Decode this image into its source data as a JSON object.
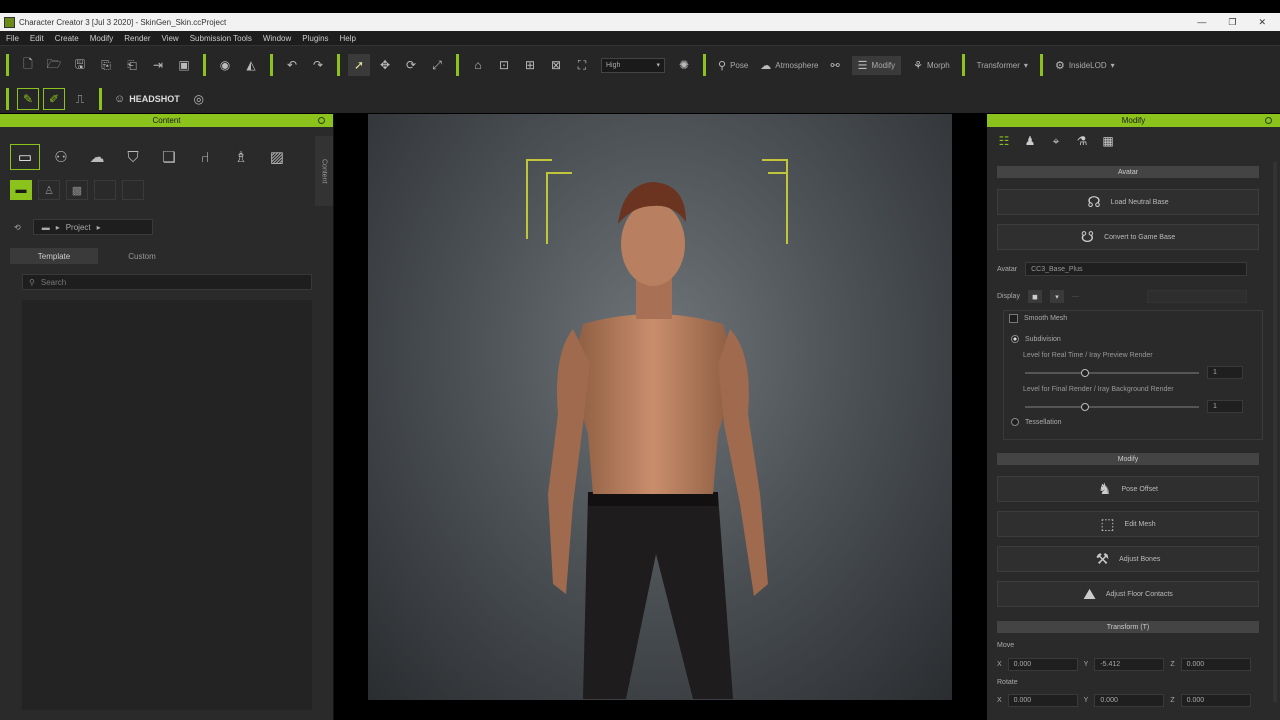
{
  "window": {
    "title": "Character Creator 3 [Jul 3 2020] - SkinGen_Skin.ccProject"
  },
  "menu": [
    "File",
    "Edit",
    "Create",
    "Modify",
    "Render",
    "View",
    "Submission Tools",
    "Window",
    "Plugins",
    "Help"
  ],
  "toolbar": {
    "quality": "High",
    "pose": "Pose",
    "atmosphere": "Atmosphere",
    "modify": "Modify",
    "morph": "Morph",
    "transformer": "Transformer",
    "insideLod": "InsideLOD",
    "headshot": "HEADSHOT"
  },
  "content": {
    "title": "Content",
    "side_tab": "Content",
    "project": "Project",
    "tabs": [
      "Template",
      "Custom"
    ],
    "search_placeholder": "Search"
  },
  "modify": {
    "title": "Modify",
    "avatar_section": "Avatar",
    "load_neutral": "Load Neutral Base",
    "convert_game": "Convert to Game Base",
    "avatar_label": "Avatar",
    "avatar_value": "CC3_Base_Plus",
    "display_label": "Display",
    "smooth_mesh": "Smooth Mesh",
    "subdivision": "Subdivision",
    "level_realtime": "Level for Real Time / Iray Preview Render",
    "level_final": "Level for Final Render / Iray Background Render",
    "level_realtime_value": "1",
    "level_final_value": "1",
    "tessellation": "Tessellation",
    "modify_section": "Modify",
    "pose_offset": "Pose Offset",
    "edit_mesh": "Edit Mesh",
    "adjust_bones": "Adjust Bones",
    "adjust_floor": "Adjust Floor Contacts",
    "transform_section": "Transform (T)",
    "move_label": "Move",
    "rotate_label": "Rotate",
    "move_x": "0.000",
    "move_y": "-5.412",
    "move_z": "0.000",
    "rot_x": "0.000",
    "rot_y": "0.000",
    "rot_z": "0.000",
    "x": "X",
    "y": "Y",
    "z": "Z"
  },
  "colors": {
    "accent": "#8bc21c",
    "panel": "#2a2a2a",
    "bracket": "#c2c43a"
  }
}
